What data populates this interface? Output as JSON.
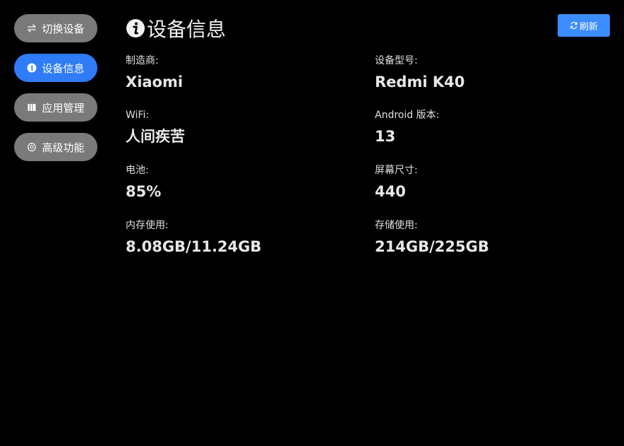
{
  "sidebar": {
    "items": [
      {
        "label": "切换设备",
        "icon": "switch-arrows-icon",
        "active": false
      },
      {
        "label": "设备信息",
        "icon": "info-icon",
        "active": true
      },
      {
        "label": "应用管理",
        "icon": "apps-book-icon",
        "active": false
      },
      {
        "label": "高级功能",
        "icon": "gear-icon",
        "active": false
      }
    ]
  },
  "header": {
    "title": "设备信息",
    "title_icon": "info-icon",
    "refresh_label": "刷新",
    "refresh_icon": "refresh-icon"
  },
  "device_info": {
    "manufacturer": {
      "label": "制造商:",
      "value": "Xiaomi"
    },
    "model": {
      "label": "设备型号:",
      "value": "Redmi K40"
    },
    "wifi": {
      "label": "WiFi:",
      "value": "人间疾苦"
    },
    "android_version": {
      "label": "Android 版本:",
      "value": "13"
    },
    "battery": {
      "label": "电池:",
      "value": "85%"
    },
    "screen_size": {
      "label": "屏幕尺寸:",
      "value": "440"
    },
    "memory": {
      "label": "内存使用:",
      "value": "8.08GB/11.24GB"
    },
    "storage": {
      "label": "存储使用:",
      "value": "214GB/225GB"
    }
  },
  "colors": {
    "background": "#000000",
    "active_nav": "#2f7cf6",
    "inactive_nav": "#7a7a7a",
    "refresh_button": "#3c8dff"
  }
}
